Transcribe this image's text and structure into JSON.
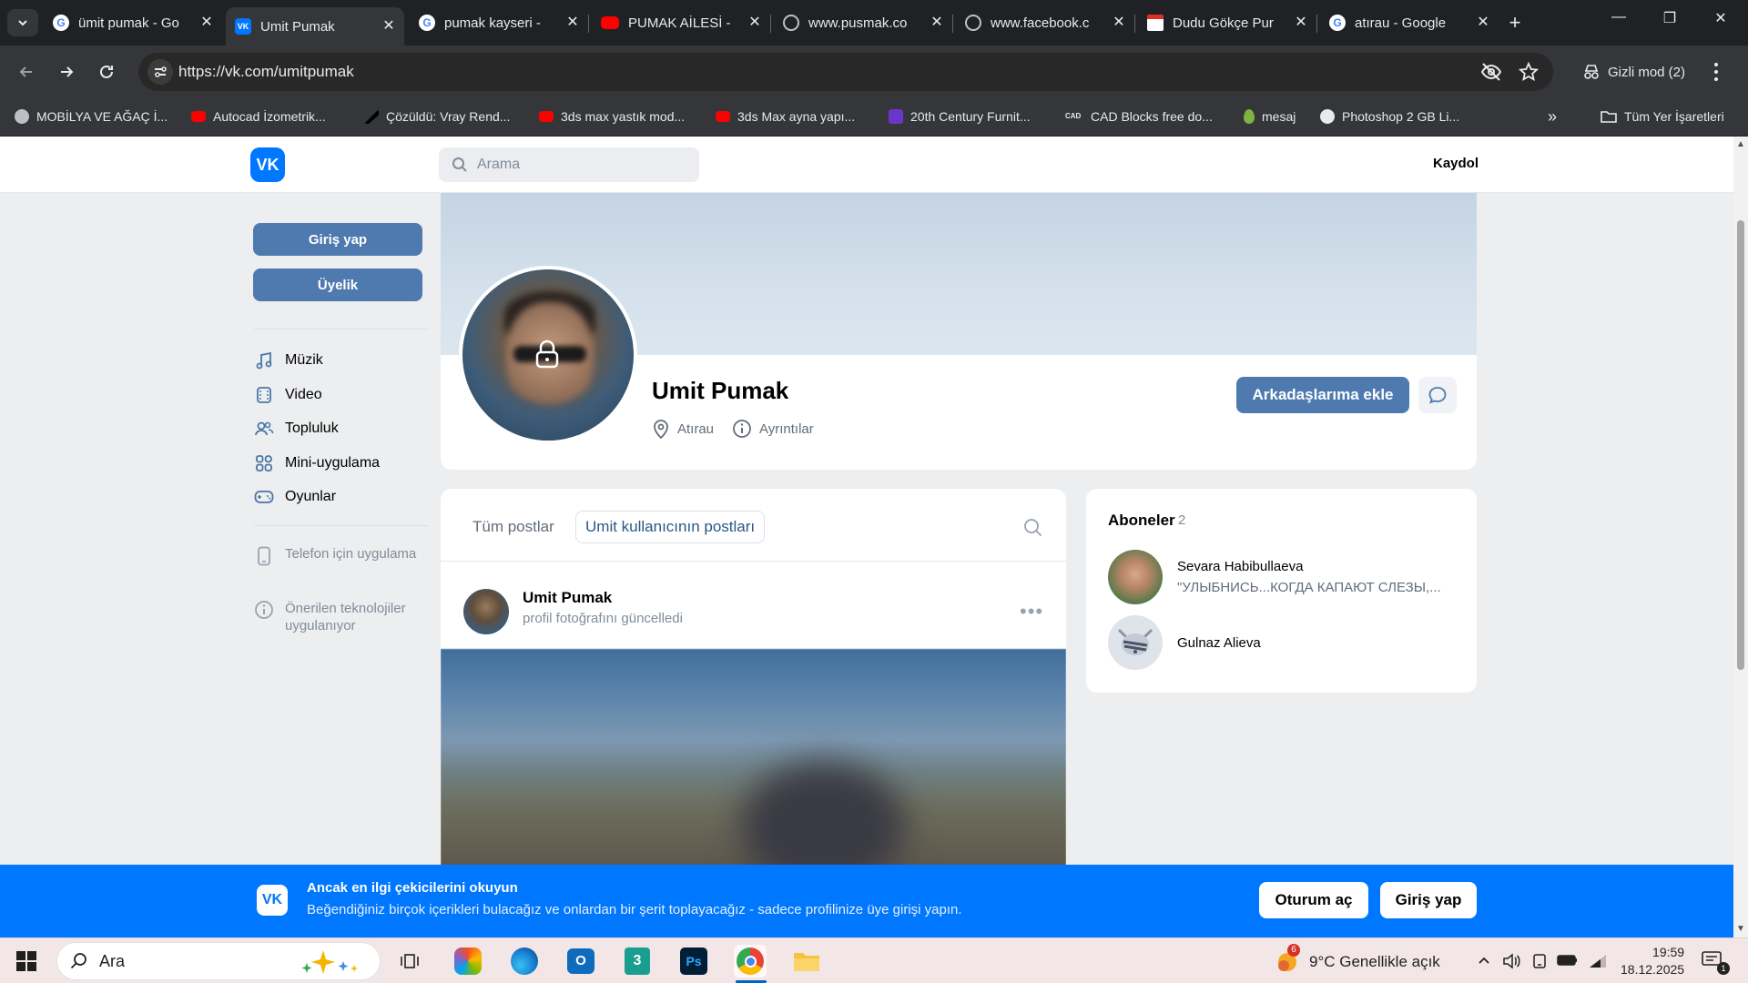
{
  "browser": {
    "tabs": [
      {
        "title": "ümit pumak - Go",
        "favicon": "google-icon"
      },
      {
        "title": "Umit Pumak",
        "favicon": "vk-icon",
        "active": true
      },
      {
        "title": "pumak kayseri - ",
        "favicon": "google-icon"
      },
      {
        "title": "PUMAK AİLESİ - ",
        "favicon": "youtube-icon"
      },
      {
        "title": "www.pusmak.co",
        "favicon": "globe-icon"
      },
      {
        "title": "www.facebook.c",
        "favicon": "globe-icon"
      },
      {
        "title": "Dudu Gökçe Pur",
        "favicon": "page-icon"
      },
      {
        "title": "atırau - Google",
        "favicon": "google-icon"
      }
    ],
    "url": "https://vk.com/umitpumak",
    "incognito_label": "Gizli mod (2)",
    "bookmarks": [
      {
        "label": "MOBİLYA VE AĞAÇ İ...",
        "icon": "globe-icon"
      },
      {
        "label": "Autocad İzometrik...",
        "icon": "youtube-icon"
      },
      {
        "label": "Çözüldü: Vray Rend...",
        "icon": "autodesk-icon"
      },
      {
        "label": "3ds max yastık mod...",
        "icon": "youtube-icon"
      },
      {
        "label": "3ds Max ayna yapı...",
        "icon": "youtube-icon"
      },
      {
        "label": "20th Century Furnit...",
        "icon": "purple-square-icon"
      },
      {
        "label": "CAD Blocks free do...",
        "icon": "cad-icon"
      },
      {
        "label": "mesaj",
        "icon": "drop-icon"
      },
      {
        "label": "Photoshop 2 GB Li...",
        "icon": "wordpress-icon"
      }
    ],
    "all_bookmarks_label": "Tüm Yer İşaretleri"
  },
  "vk": {
    "logo": "VK",
    "search_placeholder": "Arama",
    "signup_label": "Kaydol",
    "left": {
      "login_label": "Giriş yap",
      "membership_label": "Üyelik",
      "nav": [
        {
          "label": "Müzik",
          "icon": "music-icon"
        },
        {
          "label": "Video",
          "icon": "video-icon"
        },
        {
          "label": "Topluluk",
          "icon": "community-icon"
        },
        {
          "label": "Mini-uygulama",
          "icon": "apps-icon"
        },
        {
          "label": "Oyunlar",
          "icon": "gamepad-icon"
        }
      ],
      "phone_app_label": "Telefon için uygulama",
      "recommended_label": "Önerilen teknolojiler uygulanıyor"
    },
    "profile": {
      "name": "Umit Pumak",
      "city": "Atırau",
      "details_label": "Ayrıntılar",
      "add_friend_label": "Arkadaşlarıma ekle"
    },
    "posts": {
      "tab_all": "Tüm postlar",
      "tab_user": "Umit kullanıcının postları",
      "post_author": "Umit Pumak",
      "post_action": "profil fotoğrafını güncelledi"
    },
    "subscribers": {
      "title": "Aboneler",
      "count": "2",
      "items": [
        {
          "name": "Sevara Habibullaeva",
          "status": "\"УЛЫБНИСЬ...КОГДА КАПАЮТ СЛЕЗЫ,..."
        },
        {
          "name": "Gulnaz Alieva",
          "status": ""
        }
      ]
    },
    "banner": {
      "title": "Ancak en ilgi çekicilerini okuyun",
      "subtitle": "Beğendiğiniz birçok içerikleri bulacağız ve onlardan bir şerit toplayacağız - sadece profilinize üye girişi yapın.",
      "open_session_label": "Oturum aç",
      "login_label": "Giriş yap"
    }
  },
  "taskbar": {
    "search_placeholder": "Ara",
    "weather_badge": "6",
    "weather": "9°C  Genellikle açık",
    "time": "19:59",
    "date": "18.12.2025",
    "notification_count": "1"
  },
  "colors": {
    "vk_blue": "#0077ff",
    "vk_button": "#4f7ab0",
    "chrome_dark": "#202124",
    "page_bg": "#edeef0"
  }
}
